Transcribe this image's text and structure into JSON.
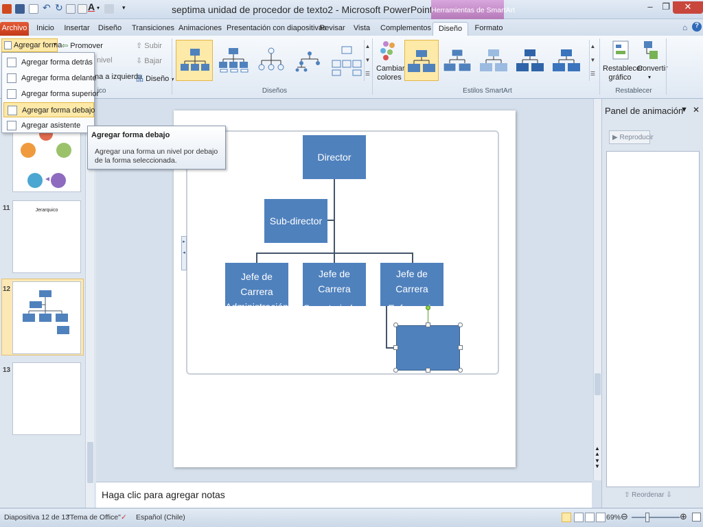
{
  "window": {
    "title": "septima unidad de procedor de texto2 - Microsoft PowerPoint",
    "context_header": "Herramientas de SmartArt"
  },
  "tabs": [
    {
      "label": "Archivo"
    },
    {
      "label": "Inicio"
    },
    {
      "label": "Insertar"
    },
    {
      "label": "Diseño"
    },
    {
      "label": "Transiciones"
    },
    {
      "label": "Animaciones"
    },
    {
      "label": "Presentación con diapositivas"
    },
    {
      "label": "Revisar"
    },
    {
      "label": "Vista"
    },
    {
      "label": "Complementos"
    },
    {
      "label": "Diseño"
    },
    {
      "label": "Formato"
    }
  ],
  "ribbon": {
    "create_graphic": {
      "add_shape": "Agregar forma",
      "promote": "Promover",
      "demote_partial": "nivel",
      "move_up": "Subir",
      "move_down": "Bajar",
      "right_to_left_partial": "na a izquierda",
      "layout": "Diseño",
      "group_label_partial": "ico"
    },
    "layouts_label": "Diseños",
    "change_colors": "Cambiar colores",
    "styles_label": "Estilos SmartArt",
    "reset_graphic": "Restablecer gráfico",
    "convert": "Convertir",
    "reset_label": "Restablecer"
  },
  "add_shape_menu": {
    "items": [
      {
        "label": "Agregar forma detrás"
      },
      {
        "label": "Agregar forma delante"
      },
      {
        "label": "Agregar forma superior"
      },
      {
        "label": "Agregar forma debajo"
      },
      {
        "label": "Agregar asistente"
      }
    ],
    "highlighted_index": 3
  },
  "tooltip": {
    "title": "Agregar forma debajo",
    "body": "Agregar una forma un nivel por debajo de la forma seleccionada."
  },
  "slides_pane": {
    "slides": [
      {
        "number": "11",
        "title": "Jerarquico"
      },
      {
        "number": "12"
      },
      {
        "number": "13"
      }
    ],
    "selected": "12"
  },
  "org_chart": {
    "director": "Director",
    "sub_director": "Sub-director",
    "children": [
      {
        "line1": "Jefe de Carrera",
        "line2": "Administración"
      },
      {
        "line1": "Jefe de Carrera",
        "line2": "Secretariado"
      },
      {
        "line1": "Jefe de Carrera",
        "line2": "Enfermería"
      }
    ],
    "box_color": "#4f81bd"
  },
  "notes": {
    "placeholder": "Haga clic para agregar notas"
  },
  "animation_pane": {
    "title": "Panel de animación",
    "play": "Reproducir",
    "reorder": "Reordenar"
  },
  "status": {
    "slide": "Diapositiva 12 de 13",
    "theme": "\"Tema de Office\"",
    "language": "Español (Chile)",
    "zoom": "69%",
    "zoom_value": 69
  }
}
